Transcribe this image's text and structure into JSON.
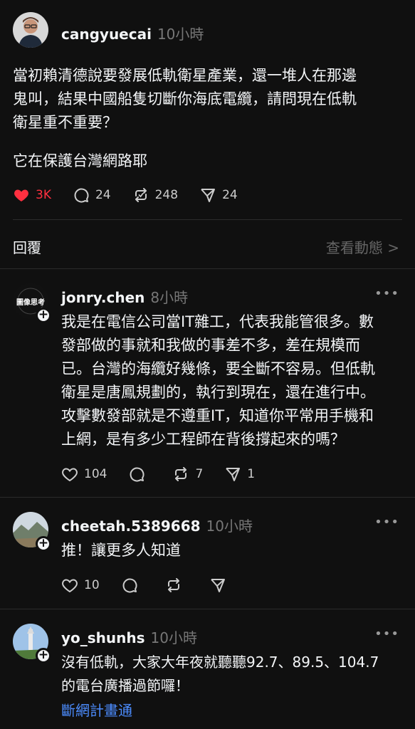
{
  "main_post": {
    "username": "cangyuecai",
    "time": "10小時",
    "text_lines": [
      "當初賴清德說要發展低軌衛星產業，還一堆人在那邊",
      "鬼叫，結果中國船隻切斷你海底電纜，請問現在低軌",
      "衛星重不重要？"
    ],
    "text2": "它在保護台灣網路耶",
    "likes": "3K",
    "comments": "24",
    "reposts": "248",
    "shares": "24"
  },
  "reply_bar": {
    "label": "回覆",
    "view_activity": "查看動態 >"
  },
  "replies": [
    {
      "username": "jonry.chen",
      "time": "8小時",
      "avatar_text": "圖像思考",
      "text_lines": [
        "我是在電信公司當IT雜工，代表我能管很多。數",
        "發部做的事就和我做的事差不多，差在規模而",
        "已。台灣的海纜好幾條，要全斷不容易。但低軌",
        "衛星是唐鳳規劃的，執行到現在，還在進行中。",
        "攻擊數發部就是不遵重IT，知道你平常用手機和",
        "上網，是有多少工程師在背後撐起來的嗎？"
      ],
      "likes": "104",
      "comments": "",
      "reposts": "7",
      "shares": "1"
    },
    {
      "username": "cheetah.5389668",
      "time": "10小時",
      "text_lines": [
        "推！讓更多人知道"
      ],
      "likes": "10",
      "comments": "",
      "reposts": "",
      "shares": ""
    },
    {
      "username": "yo_shunhs",
      "time": "10小時",
      "text_lines": [
        "沒有低軌，大家大年夜就聽聽92.7、89.5、104.7",
        "的電台廣播過節囉！"
      ],
      "link": "斷網計畫通"
    }
  ],
  "icons": {
    "heart_filled": "heart-filled-icon",
    "heart": "heart-icon",
    "comment": "comment-icon",
    "repost": "repost-icon",
    "share": "send-icon",
    "more": "more-icon",
    "follow": "plus-icon"
  },
  "colors": {
    "background": "#101010",
    "text": "#f3f5f7",
    "muted": "#777777",
    "like_red": "#ff3040",
    "link_blue": "#4c8dff"
  }
}
